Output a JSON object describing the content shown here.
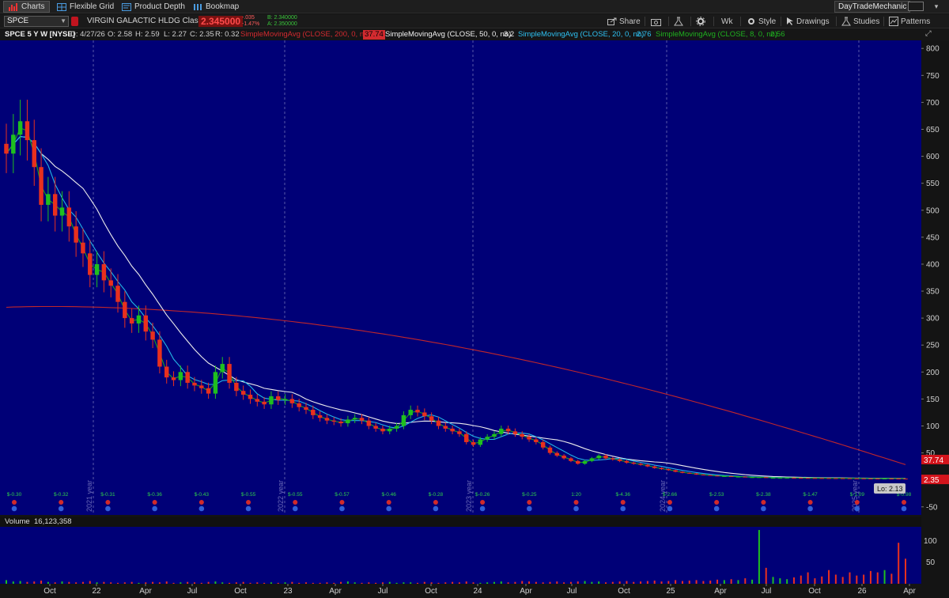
{
  "tabs": [
    {
      "label": "Charts",
      "active": true,
      "icon": "chart-bars-icon"
    },
    {
      "label": "Flexible Grid",
      "active": false,
      "icon": "grid-icon"
    },
    {
      "label": "Product Depth",
      "active": false,
      "icon": "depth-icon"
    },
    {
      "label": "Bookmap",
      "active": false,
      "icon": "bookmap-icon"
    }
  ],
  "account": "DayTradeMechanic",
  "toolbar": {
    "symbol": "SPCE",
    "company": "VIRGIN GALACTIC HLDG Class A",
    "last": "2.345000",
    "net_change": "-.035",
    "pct_change": "-1.47%",
    "bid": "B: 2.340000",
    "ask": "A: 2.350000",
    "buttons": [
      "Share",
      "Wk",
      "Style",
      "Drawings",
      "Studies",
      "Patterns"
    ]
  },
  "studies": {
    "header": "SPCE 5 Y W [NYSE]",
    "ohlc": [
      "D: 4/27/26",
      "O: 2.58",
      "H: 2.59",
      "L: 2.27",
      "C: 2.35",
      "R: 0.32"
    ],
    "sma200_label": "SimpleMovingAvg (CLOSE, 200, 0, no)",
    "sma200_value": "37.74",
    "sma50_label": "SimpleMovingAvg (CLOSE, 50, 0, no)",
    "sma50_value": "3.2",
    "sma20_label": "SimpleMovingAvg (CLOSE, 20, 0, no)",
    "sma20_value": "2.76",
    "sma8_label": "SimpleMovingAvg (CLOSE, 8, 0, no)",
    "sma8_value": "2.56"
  },
  "volume": {
    "label": "Volume",
    "value": "16,123,358",
    "ticks": [
      "100",
      "50"
    ]
  },
  "colors": {
    "bg": "#000077",
    "up": "#1fbf1f",
    "down": "#e8301e",
    "sma200": "#c0262b",
    "sma50": "#ededed",
    "sma20": "#22b6e6",
    "sma8": "#1aa01a",
    "last_tag": "#d4141c",
    "sma200_tag": "#d4141c"
  },
  "chart_data": {
    "type": "candlestick",
    "price_ticks": [
      800,
      750,
      700,
      650,
      600,
      550,
      500,
      450,
      400,
      350,
      300,
      250,
      200,
      150,
      100,
      50,
      -50
    ],
    "ylim": [
      -65,
      815
    ],
    "tags": {
      "sma200": "37.74",
      "last": "2.35",
      "low": "Lo: 2.13"
    },
    "year_labels": [
      "2021 year",
      "2022 year",
      "2023 year",
      "2024 year",
      "2025 year"
    ],
    "time_labels": [
      "Oct",
      "22",
      "Apr",
      "Jul",
      "Oct",
      "23",
      "Apr",
      "Jul",
      "Oct",
      "24",
      "Apr",
      "Jul",
      "Oct",
      "25",
      "Apr",
      "Jul",
      "Oct",
      "26",
      "Apr"
    ],
    "earnings": [
      "$-0.30",
      "$-0.32",
      "$-0.31",
      "$-0.36",
      "$-0.43",
      "$-0.55",
      "$-0.55",
      "$-0.57",
      "$-0.46",
      "$-0.28",
      "$-0.26",
      "$-0.25",
      "1:20",
      "$-4.36",
      "$-2.66",
      "$-2.53",
      "$-2.38",
      "$-1.47",
      "$-1.09",
      "$-0.98"
    ],
    "candles_close": [
      605,
      640,
      665,
      630,
      580,
      510,
      530,
      490,
      505,
      470,
      440,
      420,
      380,
      400,
      370,
      360,
      330,
      300,
      290,
      305,
      275,
      260,
      210,
      190,
      185,
      200,
      180,
      175,
      170,
      160,
      200,
      215,
      180,
      165,
      158,
      150,
      145,
      140,
      155,
      148,
      150,
      142,
      135,
      130,
      120,
      115,
      110,
      108,
      105,
      112,
      115,
      110,
      100,
      95,
      90,
      95,
      100,
      120,
      130,
      125,
      118,
      110,
      100,
      95,
      90,
      85,
      70,
      65,
      75,
      80,
      85,
      95,
      90,
      85,
      80,
      75,
      70,
      60,
      50,
      45,
      40,
      35,
      30,
      35,
      40,
      45,
      40,
      38,
      35,
      32,
      30,
      28,
      25,
      22,
      20,
      18,
      15,
      13,
      12,
      10,
      9,
      8,
      7,
      7,
      6,
      6,
      5,
      5,
      5,
      4,
      4,
      4,
      4,
      3.8,
      3.6,
      3.5,
      3.4,
      3.3,
      3.2,
      3.1,
      3.0,
      2.9,
      2.8,
      2.7,
      2.6,
      2.5,
      2.6,
      2.5,
      2.4,
      2.35
    ],
    "volume_values": [
      8,
      5,
      6,
      4,
      5,
      7,
      4,
      3,
      5,
      4,
      3,
      4,
      6,
      3,
      4,
      3,
      2,
      3,
      4,
      2,
      3,
      4,
      3,
      5,
      2,
      3,
      4,
      3,
      2,
      4,
      5,
      3,
      2,
      3,
      4,
      2,
      3,
      2,
      3,
      2,
      3,
      4,
      2,
      3,
      2,
      2,
      3,
      2,
      4,
      5,
      3,
      2,
      3,
      2,
      3,
      4,
      2,
      3,
      3,
      2,
      4,
      3,
      2,
      3,
      4,
      3,
      5,
      3,
      2,
      3,
      4,
      5,
      3,
      4,
      6,
      5,
      4,
      3,
      4,
      5,
      3,
      4,
      5,
      6,
      4,
      5,
      3,
      4,
      5,
      6,
      4,
      5,
      6,
      7,
      5,
      6,
      8,
      6,
      7,
      8,
      6,
      7,
      9,
      8,
      10,
      8,
      12,
      9,
      118,
      35,
      15,
      12,
      10,
      14,
      18,
      25,
      12,
      16,
      30,
      20,
      15,
      25,
      18,
      20,
      28,
      25,
      30,
      22,
      90,
      55
    ]
  }
}
